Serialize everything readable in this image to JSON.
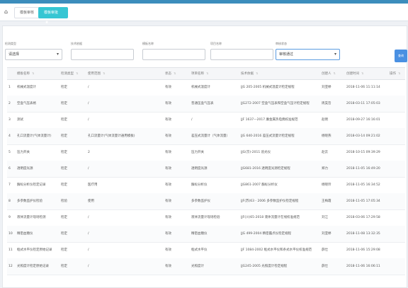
{
  "tabs": [
    {
      "label": "模板审核"
    },
    {
      "label": "模板审批",
      "close": "✖"
    }
  ],
  "filters": [
    {
      "label": "检测类型",
      "value": "请选择",
      "type": "select"
    },
    {
      "label": "技术依据",
      "value": "",
      "type": "input"
    },
    {
      "label": "模板名称",
      "value": "",
      "type": "input"
    },
    {
      "label": "项目名称",
      "value": "",
      "type": "input"
    },
    {
      "label": "审核状态",
      "value": "审核通过",
      "type": "select"
    }
  ],
  "search_label": "查询",
  "columns": [
    "模板名称",
    "检测类型",
    "使用范围",
    "状态",
    "项目名称",
    "技术依据",
    "创建人",
    "创建时间",
    "操作"
  ],
  "rows": [
    {
      "n": "1",
      "name": "机械式温度计",
      "type": "检定",
      "scope": "/",
      "status": "有效",
      "project": "机械式温度计",
      "basis": "JJG 205-2005 机械式温度计检定规程",
      "creator": "刘亚婷",
      "time": "2018-11-06 11:11:14"
    },
    {
      "n": "2",
      "name": "空盒气压表格",
      "type": "检定",
      "scope": "/",
      "status": "有效",
      "project": "普通压盒气压表",
      "basis": "JJG272-2007 空盒气压表和空盒气压计检定规程",
      "creator": "周昊哲",
      "time": "2018-03-11 17:05:03"
    },
    {
      "n": "3",
      "name": "测试",
      "type": "检定",
      "scope": "/",
      "status": "有效",
      "project": "/",
      "basis": "JJF 1637—2017 廉金属热电偶校准规范",
      "creator": "赵明",
      "time": "2018-09-27 16:16:01"
    },
    {
      "n": "4",
      "name": "孔口流量计(气体流量计)",
      "type": "检定",
      "scope": "孔口流量计(气体流量计通用模板)",
      "status": "有效",
      "project": "差压式流量计（气体流量）",
      "basis": "JJG 640-2016 差压式流量计检定规程",
      "creator": "杨晓燕",
      "time": "2018-03-14 09:21:02"
    },
    {
      "n": "5",
      "name": "压力开关",
      "type": "检定",
      "scope": "2",
      "status": "有效",
      "project": "压力开关",
      "basis": "JJG(京)-2011 验光仪",
      "creator": "赵云",
      "time": "2018-10-15 09:39:29"
    },
    {
      "n": "6",
      "name": "透明度光源",
      "type": "检定",
      "scope": "/",
      "status": "有效",
      "project": "透明度光源",
      "basis": "JJG681-2016 透明度光源检定规程",
      "creator": "郑力",
      "time": "2018-11-05 16:49:20"
    },
    {
      "n": "7",
      "name": "酶标分析仪检定记录",
      "type": "检定",
      "scope": "医疗用",
      "status": "有效",
      "project": "酶标分析仪",
      "basis": "JJG861-2007 酶标分析仪",
      "creator": "杨晓玲",
      "time": "2018-11-05 16:34:52"
    },
    {
      "n": "8",
      "name": "多参数监护仪检验",
      "type": "检验",
      "scope": "使用",
      "status": "有效",
      "project": "多参数监护仪",
      "basis": "JJF(苏)63 - 2006 多参数监护仪检定规程",
      "creator": "王梅霞",
      "time": "2018-11-05 17:05:34"
    },
    {
      "n": "9",
      "name": "液体流量计现场检测",
      "type": "检定",
      "scope": "/",
      "status": "有效",
      "project": "液体流量计现场检验",
      "basis": "JJF(川)65-2018 液体流量计在线校准规范",
      "creator": "刘江",
      "time": "2018-03-06 17:29:58"
    },
    {
      "n": "10",
      "name": "精密血糖仪",
      "type": "检定",
      "scope": "/",
      "status": "有效",
      "project": "精密血糖仪",
      "basis": "JJG 499-2004 精密露点仪检定规程",
      "creator": "刘亚婷",
      "time": "2018-11-08 13:32:35"
    },
    {
      "n": "11",
      "name": "框式水平仪检定原始记录",
      "type": "检定",
      "scope": "/",
      "status": "有效",
      "project": "框式水平仪",
      "basis": "JJF 1084-2002 框式水平仪和条式水平仪校准规范",
      "creator": "薛仕",
      "time": "2018-11-06 15:29:08"
    },
    {
      "n": "12",
      "name": "光照度计检定原始记录",
      "type": "检定",
      "scope": "/",
      "status": "有效",
      "project": "光照度计",
      "basis": "JJG245-2005 光照度计检定规程",
      "creator": "薛仕",
      "time": "2018-11-06 16:06:11"
    }
  ]
}
